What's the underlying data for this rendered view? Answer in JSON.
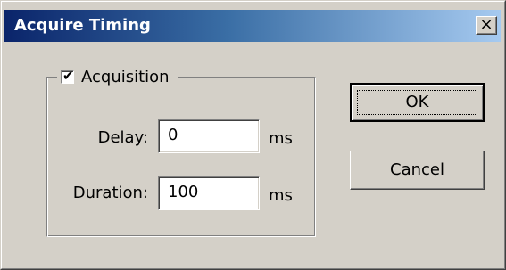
{
  "window": {
    "title": "Acquire Timing",
    "close_label": "×"
  },
  "group": {
    "checkbox_checked": true,
    "checkbox_mark": "✔",
    "label": "Acquisition"
  },
  "fields": {
    "delay": {
      "label": "Delay:",
      "value": "0",
      "unit": "ms"
    },
    "duration": {
      "label": "Duration:",
      "value": "100",
      "unit": "ms"
    }
  },
  "buttons": {
    "ok_label": "OK",
    "cancel_label": "Cancel"
  },
  "colors": {
    "titlebar_start": "#0a246a",
    "titlebar_end": "#a6caf0",
    "face": "#d4d0c8"
  }
}
